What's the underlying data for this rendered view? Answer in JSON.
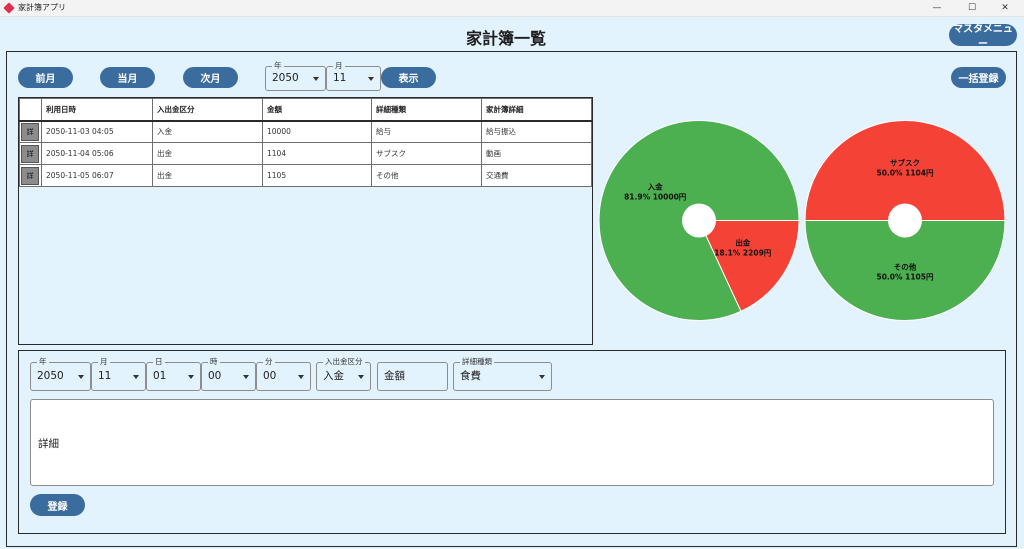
{
  "app": {
    "title": "家計簿アプリ",
    "minimize": "—",
    "maximize": "☐",
    "close": "✕"
  },
  "header": {
    "title": "家計簿一覧",
    "master_menu": "マスタメニュー"
  },
  "nav": {
    "prev": "前月",
    "current": "当月",
    "next": "次月",
    "show": "表示",
    "bulk": "一括登録"
  },
  "filter": {
    "year": {
      "label": "年",
      "value": "2050"
    },
    "month": {
      "label": "月",
      "value": "11"
    }
  },
  "table": {
    "headers": [
      "",
      "利用日時",
      "入出金区分",
      "金額",
      "詳細種類",
      "家計簿詳細"
    ],
    "detail_label": "詳",
    "rows": [
      {
        "datetime": "2050-11-03 04:05",
        "kind": "入金",
        "amount": "10000",
        "category": "給与",
        "memo": "給与振込"
      },
      {
        "datetime": "2050-11-04 05:06",
        "kind": "出金",
        "amount": "1104",
        "category": "サブスク",
        "memo": "動画"
      },
      {
        "datetime": "2050-11-05 06:07",
        "kind": "出金",
        "amount": "1105",
        "category": "その他",
        "memo": "交通費"
      }
    ]
  },
  "chart_data": [
    {
      "type": "pie",
      "donut": true,
      "slices": [
        {
          "label": "入金",
          "percent": 81.9,
          "value": 10000,
          "value_text": "81.9% 10000円",
          "color": "#4caf50"
        },
        {
          "label": "出金",
          "percent": 18.1,
          "value": 2209,
          "value_text": "18.1% 2209円",
          "color": "#f44336"
        }
      ]
    },
    {
      "type": "pie",
      "donut": true,
      "slices": [
        {
          "label": "サブスク",
          "percent": 50.0,
          "value": 1104,
          "value_text": "50.0% 1104円",
          "color": "#f44336"
        },
        {
          "label": "その他",
          "percent": 50.0,
          "value": 1105,
          "value_text": "50.0% 1105円",
          "color": "#4caf50"
        }
      ]
    }
  ],
  "form": {
    "year": {
      "label": "年",
      "value": "2050"
    },
    "month": {
      "label": "月",
      "value": "11"
    },
    "day": {
      "label": "日",
      "value": "01"
    },
    "hour": {
      "label": "時",
      "value": "00"
    },
    "minute": {
      "label": "分",
      "value": "00"
    },
    "kind": {
      "label": "入出金区分",
      "value": "入金"
    },
    "amount_placeholder": "金額",
    "category": {
      "label": "詳細種類",
      "value": "食費"
    },
    "detail_placeholder": "詳細",
    "register": "登録"
  },
  "colors": {
    "button": "#3b6c9e",
    "background": "#e2f3fd",
    "green": "#4caf50",
    "red": "#f44336"
  }
}
